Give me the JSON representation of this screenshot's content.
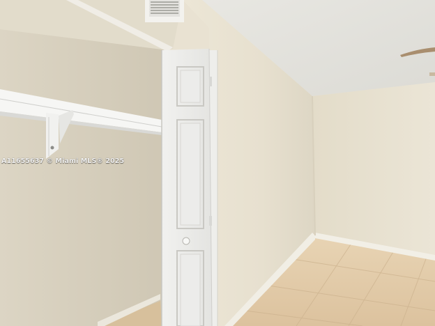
{
  "photo": {
    "watermark": "A11655637 © Miami MLS® 2025"
  }
}
